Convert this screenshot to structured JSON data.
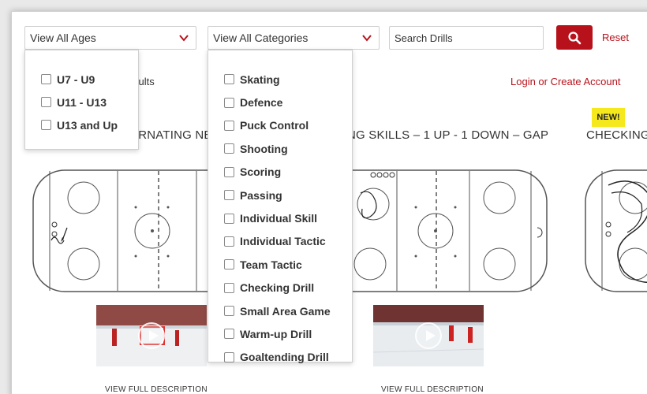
{
  "filters": {
    "ages_label": "View All Ages",
    "categories_label": "View All Categories",
    "search_placeholder": "Search Drills",
    "reset_label": "Reset"
  },
  "ages_options": [
    "U7 - U9",
    "U11 - U13",
    "U13 and Up"
  ],
  "category_options": [
    "Skating",
    "Defence",
    "Puck Control",
    "Shooting",
    "Scoring",
    "Passing",
    "Individual Skill",
    "Individual Tactic",
    "Team Tactic",
    "Checking Drill",
    "Small Area Game",
    "Warm-up Drill",
    "Goaltending Drill"
  ],
  "results_text": "sults",
  "login_label": "Login or Create Account",
  "drills": [
    {
      "title": "ERNATING NE",
      "view_label": "VIEW FULL DESCRIPTION"
    },
    {
      "title": "NG SKILLS – 1 UP - 1 DOWN – GAP",
      "view_label": "VIEW FULL DESCRIPTION"
    },
    {
      "title": "CHECKING",
      "badge": "NEW!"
    }
  ],
  "colors": {
    "accent": "#b7121b",
    "badge": "#f5e91d"
  }
}
